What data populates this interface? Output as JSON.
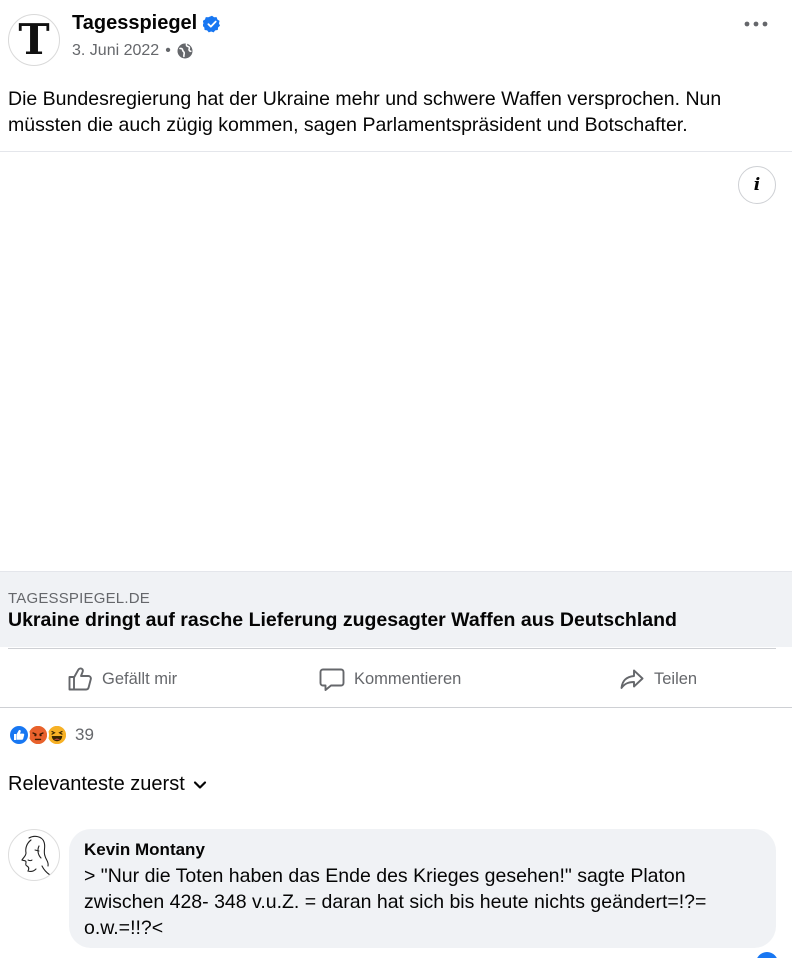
{
  "post": {
    "page_name": "Tagesspiegel",
    "avatar_letter": "T",
    "date": "3. Juni 2022",
    "separator": "•",
    "audience_icon": "globe-icon",
    "verified_icon": "verified-badge-icon",
    "more_icon": "more-options-icon",
    "text": "Die Bundesregierung hat der Ukraine mehr und schwere Waffen versprochen. Nun müssten die auch zügig kommen, sagen Parlamentspräsident und Botschafter."
  },
  "link_preview": {
    "info_glyph": "i",
    "domain": "TAGESSPIEGEL.DE",
    "headline": "Ukraine dringt auf rasche Lieferung zugesagter Waffen aus Deutschland"
  },
  "actions": {
    "like_label": "Gefällt mir",
    "comment_label": "Kommentieren",
    "share_label": "Teilen"
  },
  "reactions": {
    "icons": [
      "like-reaction-icon",
      "angry-reaction-icon",
      "haha-reaction-icon"
    ],
    "count": "39"
  },
  "comments": {
    "sort_label": "Relevanteste zuerst",
    "items": [
      {
        "author": "Kevin Montany",
        "text": "> \"Nur die Toten haben das Ende des Krieges gesehen!\" sagte Platon zwischen 428- 348 v.u.Z. = daran hat sich bis heute nichts geändert=!?= o.w.=!!?<"
      }
    ]
  },
  "colors": {
    "accent": "#1877f2",
    "secondary_text": "#65676b",
    "preview_bg": "#f0f2f5"
  }
}
